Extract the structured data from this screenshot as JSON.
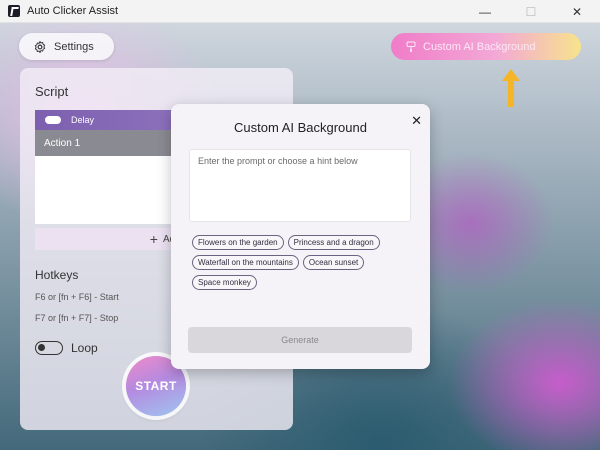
{
  "window": {
    "title": "Auto Clicker Assist",
    "controls": {
      "minimize": "—",
      "maximize": "☐",
      "close": "✕"
    }
  },
  "top_bar": {
    "settings_label": "Settings",
    "ai_background_label": "Custom AI Background"
  },
  "script_panel": {
    "title": "Script",
    "list_header_label": "Delay",
    "rows": [
      "Action 1"
    ],
    "add_label": "Ad",
    "hotkeys_title": "Hotkeys",
    "hotkey_start": "F6 or [fn + F6] - Start",
    "hotkey_stop": "F7 or [fn + F7] - Stop",
    "loop_label": "Loop",
    "start_label": "START"
  },
  "modal": {
    "title": "Custom AI Background",
    "close_icon": "✕",
    "prompt_placeholder": "Enter the prompt or choose a hint below",
    "hints": [
      "Flowers on the garden",
      "Princess and a dragon",
      "Waterfall on the mountains",
      "Ocean sunset",
      "Space monkey"
    ],
    "generate_label": "Generate"
  },
  "colors": {
    "accent_purple": "#7c5fae",
    "ai_button_gradient_start": "#f07cc8",
    "ai_button_gradient_end": "#f7e38c",
    "arrow": "#f6b526"
  }
}
